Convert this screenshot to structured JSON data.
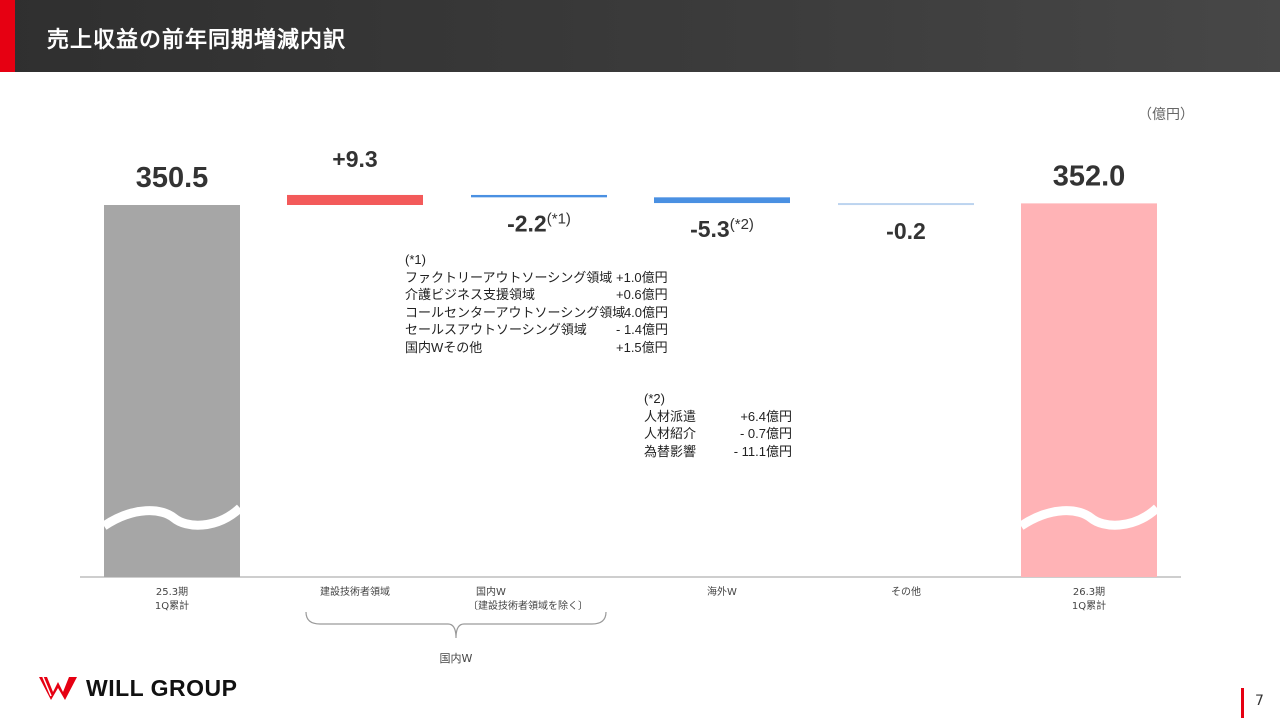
{
  "header": {
    "title": "売上収益の前年同期増減内訳"
  },
  "unit_label": "（億円）",
  "chart_data": {
    "type": "waterfall",
    "categories": [
      "25.3期\n1Q累計",
      "建設技術者領域",
      "国内W\n〔建設技術者領域を除く〕",
      "海外W",
      "その他",
      "26.3期\n1Q累計"
    ],
    "values": [
      350.5,
      9.3,
      -2.2,
      -5.3,
      -0.2,
      352.0
    ],
    "value_labels": [
      "350.5",
      "+9.3",
      "-2.2",
      "-5.3",
      "-0.2",
      "352.0"
    ],
    "footnote_marks": [
      "",
      "",
      "(*1)",
      "(*2)",
      "",
      ""
    ],
    "kinds": [
      "total",
      "increase",
      "decrease",
      "decrease",
      "decrease",
      "total"
    ],
    "colors": {
      "total_start": "#a6a6a6",
      "increase": "#f35a5a",
      "decrease": "#4a90e2",
      "decrease_light": "#bcd4ef",
      "total_end": "#ffb3b6"
    },
    "axis_break": true,
    "group_brace": {
      "label": "国内W",
      "spans": [
        "建設技術者領域",
        "国内W\n〔建設技術者領域を除く〕"
      ]
    }
  },
  "notes": {
    "n1": {
      "title": "(*1)",
      "rows": [
        {
          "name": "ファクトリーアウトソーシング領域",
          "value": "+1.0億円"
        },
        {
          "name": "介護ビジネス支援領域",
          "value": "+0.6億円"
        },
        {
          "name": "コールセンターアウトソーシング領域",
          "value": "- 4.0億円"
        },
        {
          "name": "セールスアウトソーシング領域",
          "value": "- 1.4億円"
        },
        {
          "name": "国内Wその他",
          "value": "+1.5億円"
        }
      ]
    },
    "n2": {
      "title": "(*2)",
      "rows": [
        {
          "name": "人材派遣",
          "value": "+6.4億円"
        },
        {
          "name": "人材紹介",
          "value": "- 0.7億円"
        },
        {
          "name": "為替影響",
          "value": "- 11.1億円"
        }
      ]
    }
  },
  "footer": {
    "logo_text": "WILL GROUP",
    "page_number": "7"
  }
}
